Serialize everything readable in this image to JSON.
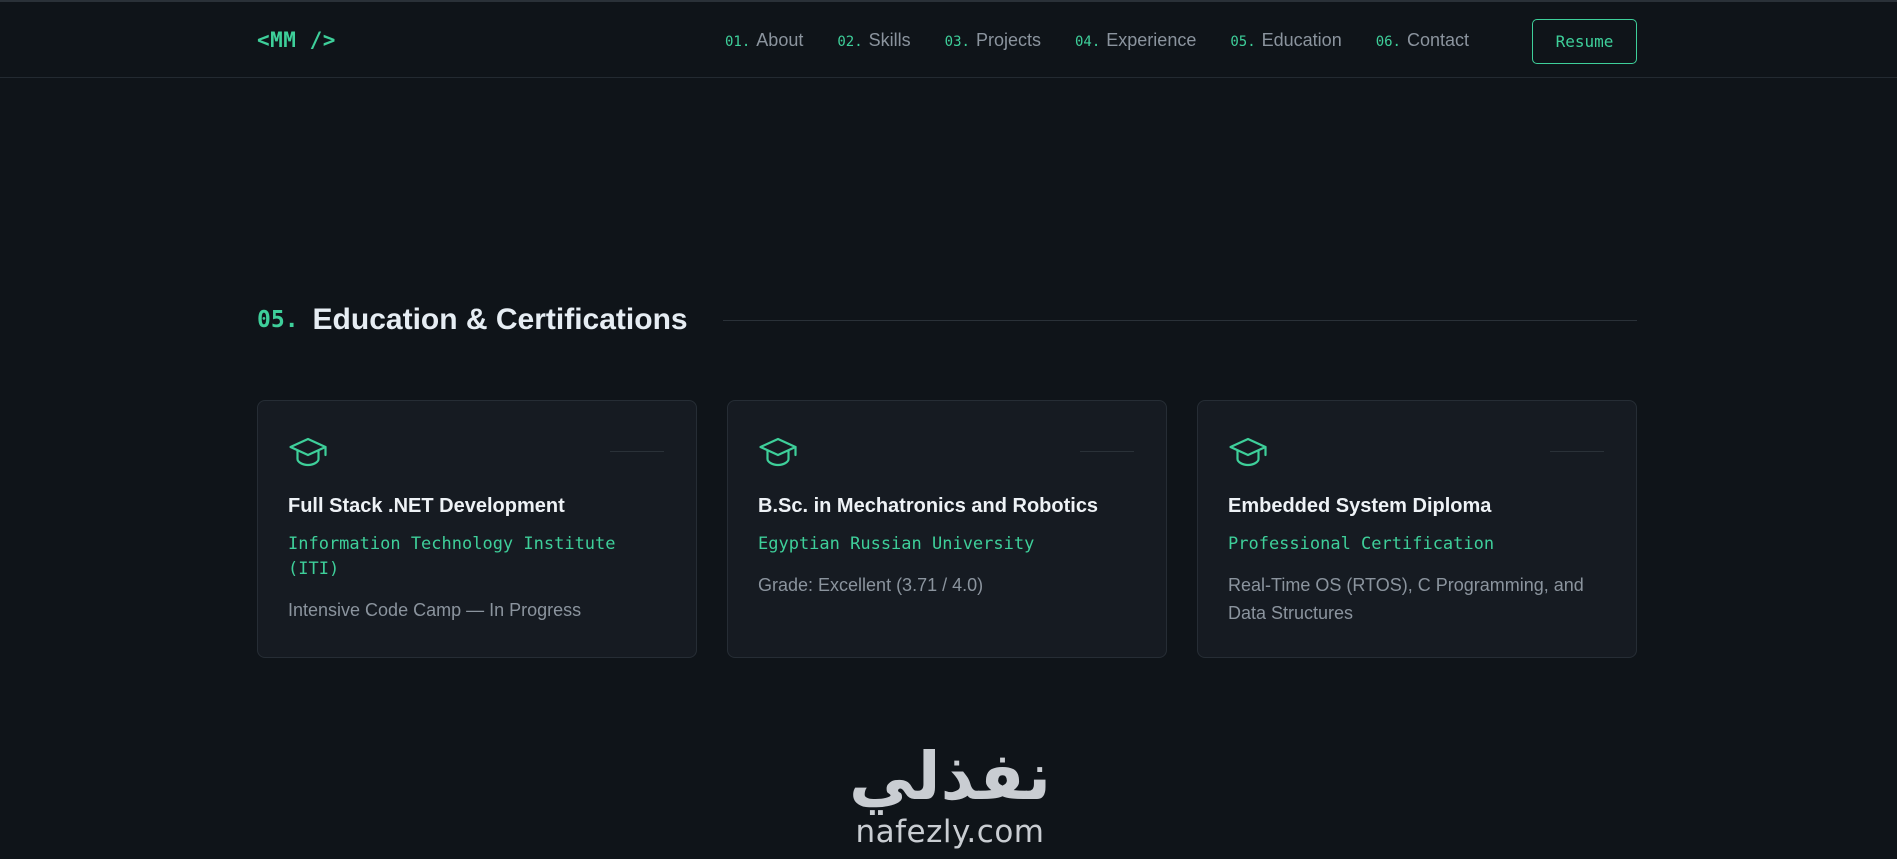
{
  "brand": {
    "logo": "<MM />",
    "accent_color": "#3ecf9a",
    "background_color": "#0f1419"
  },
  "nav": {
    "items": [
      {
        "num": "01.",
        "label": "About"
      },
      {
        "num": "02.",
        "label": "Skills"
      },
      {
        "num": "03.",
        "label": "Projects"
      },
      {
        "num": "04.",
        "label": "Experience"
      },
      {
        "num": "05.",
        "label": "Education"
      },
      {
        "num": "06.",
        "label": "Contact"
      }
    ],
    "resume_label": "Resume"
  },
  "section": {
    "num": "05.",
    "title": "Education & Certifications"
  },
  "cards": [
    {
      "icon": "graduation-cap-icon",
      "title": "Full Stack .NET Development",
      "org": "Information Technology Institute (ITI)",
      "desc": "Intensive Code Camp — In Progress"
    },
    {
      "icon": "graduation-cap-icon",
      "title": "B.Sc. in Mechatronics and Robotics",
      "org": "Egyptian Russian University",
      "desc": "Grade: Excellent (3.71 / 4.0)"
    },
    {
      "icon": "graduation-cap-icon",
      "title": "Embedded System Diploma",
      "org": "Professional Certification",
      "desc": "Real-Time OS (RTOS), C Programming, and Data Structures"
    }
  ],
  "watermark": {
    "arabic": "نفذلي",
    "latin": "nafezly.com"
  }
}
